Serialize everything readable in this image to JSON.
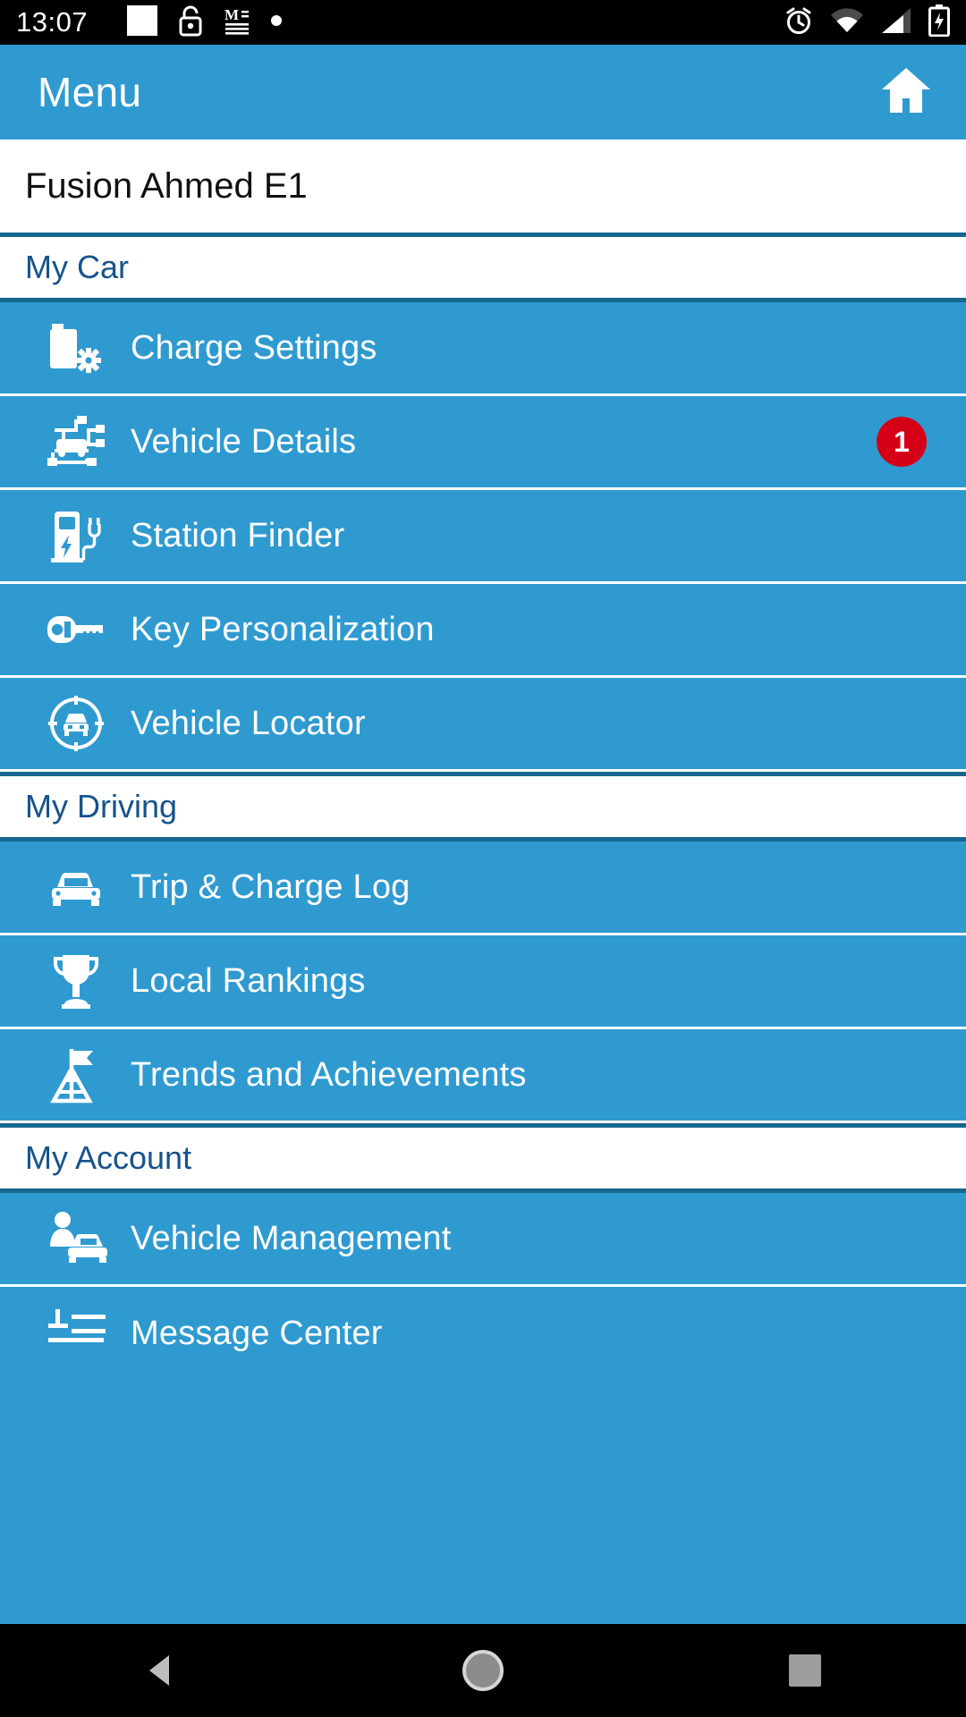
{
  "statusbar": {
    "time": "13:07",
    "left_icons": [
      "white-square-icon",
      "unlock-icon",
      "m-document-icon",
      "dot-icon"
    ],
    "right_icons": [
      "alarm-icon",
      "wifi-icon",
      "signal-icon",
      "battery-charging-icon"
    ]
  },
  "appbar": {
    "title": "Menu",
    "home_icon": "home-icon"
  },
  "vehicle": {
    "name": "Fusion Ahmed E1"
  },
  "sections": [
    {
      "label": "My Car",
      "items": [
        {
          "label": "Charge Settings",
          "icon": "battery-gear-icon",
          "badge": ""
        },
        {
          "label": "Vehicle Details",
          "icon": "vehicle-schematic-icon",
          "badge": "1"
        },
        {
          "label": "Station Finder",
          "icon": "charging-station-icon",
          "badge": ""
        },
        {
          "label": "Key Personalization",
          "icon": "key-icon",
          "badge": ""
        },
        {
          "label": "Vehicle Locator",
          "icon": "car-crosshair-icon",
          "badge": ""
        }
      ]
    },
    {
      "label": "My Driving",
      "items": [
        {
          "label": "Trip & Charge Log",
          "icon": "car-front-icon",
          "badge": ""
        },
        {
          "label": "Local Rankings",
          "icon": "trophy-icon",
          "badge": ""
        },
        {
          "label": "Trends and Achievements",
          "icon": "flag-mountain-icon",
          "badge": ""
        }
      ]
    },
    {
      "label": "My Account",
      "items": [
        {
          "label": "Vehicle Management",
          "icon": "person-car-icon",
          "badge": ""
        },
        {
          "label": "Message Center",
          "icon": "message-icon",
          "badge": ""
        }
      ]
    }
  ],
  "navbar": {
    "back_icon": "back-triangle-icon",
    "home_icon": "home-circle-icon",
    "recents_icon": "recents-square-icon"
  },
  "colors": {
    "accent_blue": "#2F9AD0",
    "section_text": "#16538C",
    "section_border": "#16678F",
    "badge_red": "#D50017"
  }
}
